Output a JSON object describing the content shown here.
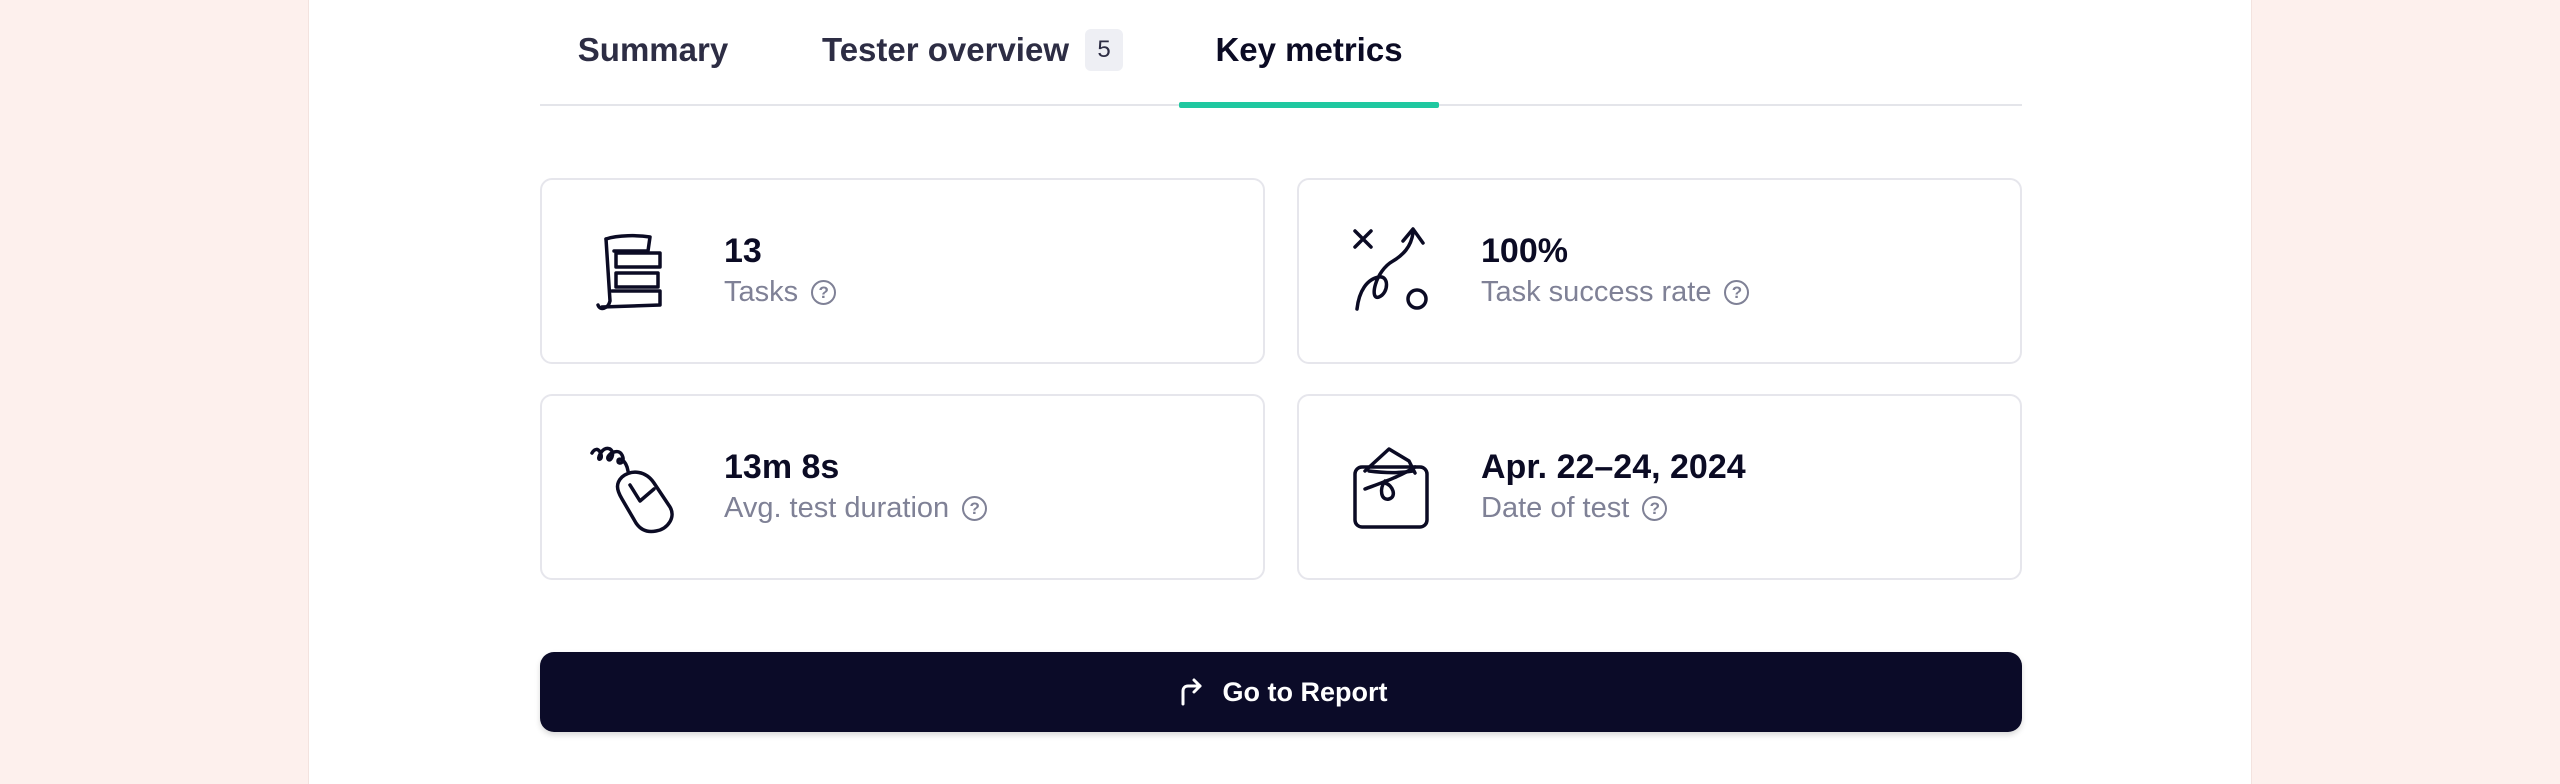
{
  "tabs": [
    {
      "label": "Summary"
    },
    {
      "label": "Tester overview",
      "badge": "5"
    },
    {
      "label": "Key metrics",
      "active": true
    }
  ],
  "metrics": [
    {
      "value": "13",
      "label": "Tasks",
      "icon": "document-stack-icon"
    },
    {
      "value": "100%",
      "label": "Task success rate",
      "icon": "strategy-arrow-icon"
    },
    {
      "value": "13m 8s",
      "label": "Avg. test duration",
      "icon": "mouse-icon"
    },
    {
      "value": "Apr. 22–24, 2024",
      "label": "Date of test",
      "icon": "envelope-icon"
    }
  ],
  "report_button": {
    "label": "Go to Report",
    "icon": "share-arrow-icon"
  },
  "colors": {
    "accent": "#1fc8a0",
    "button": "#0b0b28",
    "background": "#fdf0ed"
  }
}
